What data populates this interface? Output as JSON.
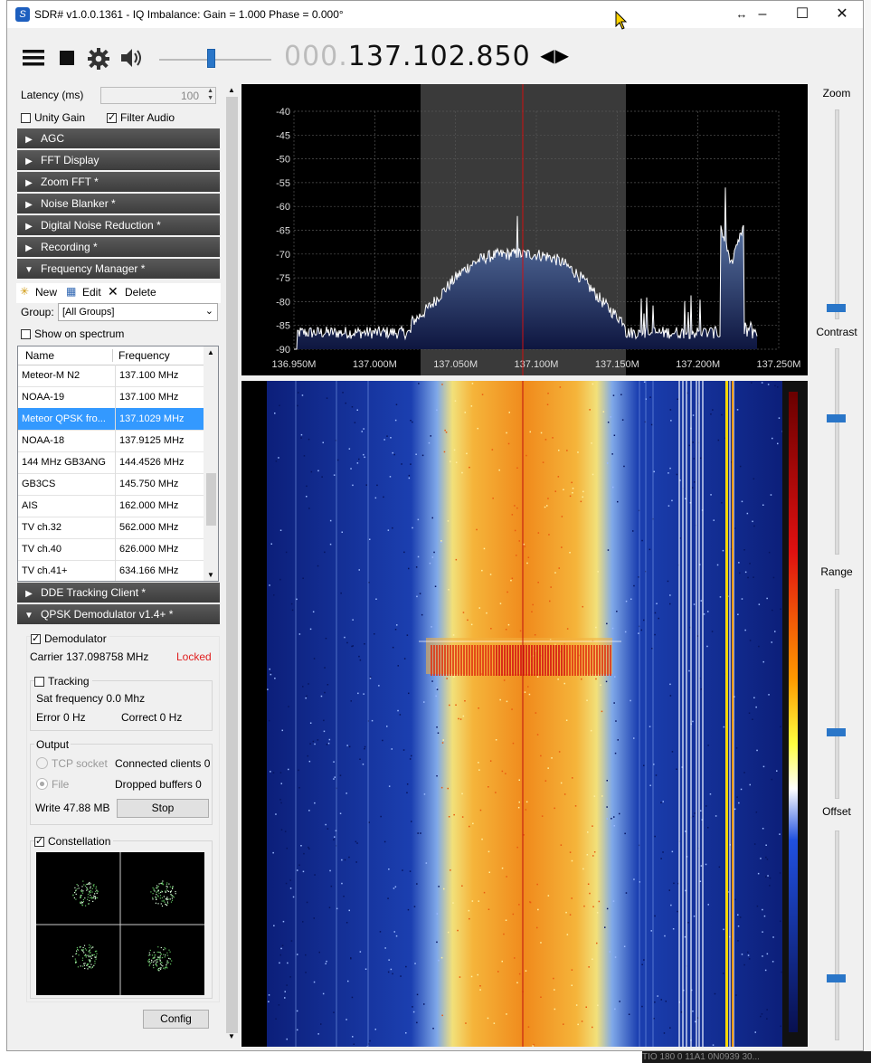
{
  "window": {
    "title": "SDR# v1.0.0.1361 - IQ Imbalance: Gain = 1.000 Phase = 0.000°",
    "icons": [
      "resize-icon",
      "minimize-icon",
      "maximize-icon",
      "close-icon"
    ]
  },
  "toolbar": {
    "freq_dim": "000.",
    "freq_main": "137.102.850",
    "volume_percent": 50
  },
  "audio": {
    "latency_label": "Latency (ms)",
    "latency_value": "100",
    "unity_gain_label": "Unity Gain",
    "unity_gain": false,
    "filter_audio_label": "Filter Audio",
    "filter_audio": true
  },
  "sections": [
    {
      "label": "AGC",
      "expanded": false
    },
    {
      "label": "FFT Display",
      "expanded": false
    },
    {
      "label": "Zoom FFT *",
      "expanded": false
    },
    {
      "label": "Noise Blanker *",
      "expanded": false
    },
    {
      "label": "Digital Noise Reduction *",
      "expanded": false
    },
    {
      "label": "Recording *",
      "expanded": false
    },
    {
      "label": "Frequency Manager *",
      "expanded": true
    },
    {
      "label": "DDE Tracking Client *",
      "expanded": false
    },
    {
      "label": "QPSK Demodulator v1.4+ *",
      "expanded": true
    }
  ],
  "freq_manager": {
    "new_label": "New",
    "edit_label": "Edit",
    "delete_label": "Delete",
    "group_label": "Group:",
    "group_value": "[All Groups]",
    "show_on_spectrum_label": "Show on spectrum",
    "col_name": "Name",
    "col_frequency": "Frequency",
    "rows": [
      {
        "name": "Meteor-M N2",
        "freq": "137.100 MHz"
      },
      {
        "name": "NOAA-19",
        "freq": "137.100 MHz"
      },
      {
        "name": "Meteor QPSK fro...",
        "freq": "137.1029 MHz"
      },
      {
        "name": "NOAA-18",
        "freq": "137.9125 MHz"
      },
      {
        "name": "144 MHz GB3ANG",
        "freq": "144.4526 MHz"
      },
      {
        "name": "GB3CS",
        "freq": "145.750 MHz"
      },
      {
        "name": "AIS",
        "freq": "162.000 MHz"
      },
      {
        "name": "TV ch.32",
        "freq": "562.000 MHz"
      },
      {
        "name": "TV ch.40",
        "freq": "626.000 MHz"
      },
      {
        "name": "TV ch.41+",
        "freq": "634.166 MHz"
      }
    ]
  },
  "qpsk": {
    "demodulator_label": "Demodulator",
    "demodulator": true,
    "carrier": "Carrier 137.098758 MHz",
    "status": "Locked",
    "tracking_label": "Tracking",
    "sat_frequency": "Sat frequency 0.0 Mhz",
    "error": "Error 0 Hz",
    "correct": "Correct 0 Hz",
    "output_label": "Output",
    "tcp_socket_label": "TCP socket",
    "connected_clients": "Connected clients 0",
    "file_label": "File",
    "dropped_buffers": "Dropped buffers 0",
    "write": "Write 47.88 MB",
    "stop_label": "Stop",
    "constellation_label": "Constellation",
    "config_label": "Config"
  },
  "spectrum": {
    "y_ticks": [
      "-40",
      "-45",
      "-50",
      "-55",
      "-60",
      "-65",
      "-70",
      "-75",
      "-80",
      "-85",
      "-90"
    ],
    "x_ticks": [
      "136.950M",
      "137.000M",
      "137.050M",
      "137.100M",
      "137.150M",
      "137.200M",
      "137.250M"
    ]
  },
  "right_controls": {
    "zoom_label": "Zoom",
    "contrast_label": "Contrast",
    "range_label": "Range",
    "offset_label": "Offset"
  },
  "taskbar_text": "TIO 180   0    11A1  0N0939   30..."
}
